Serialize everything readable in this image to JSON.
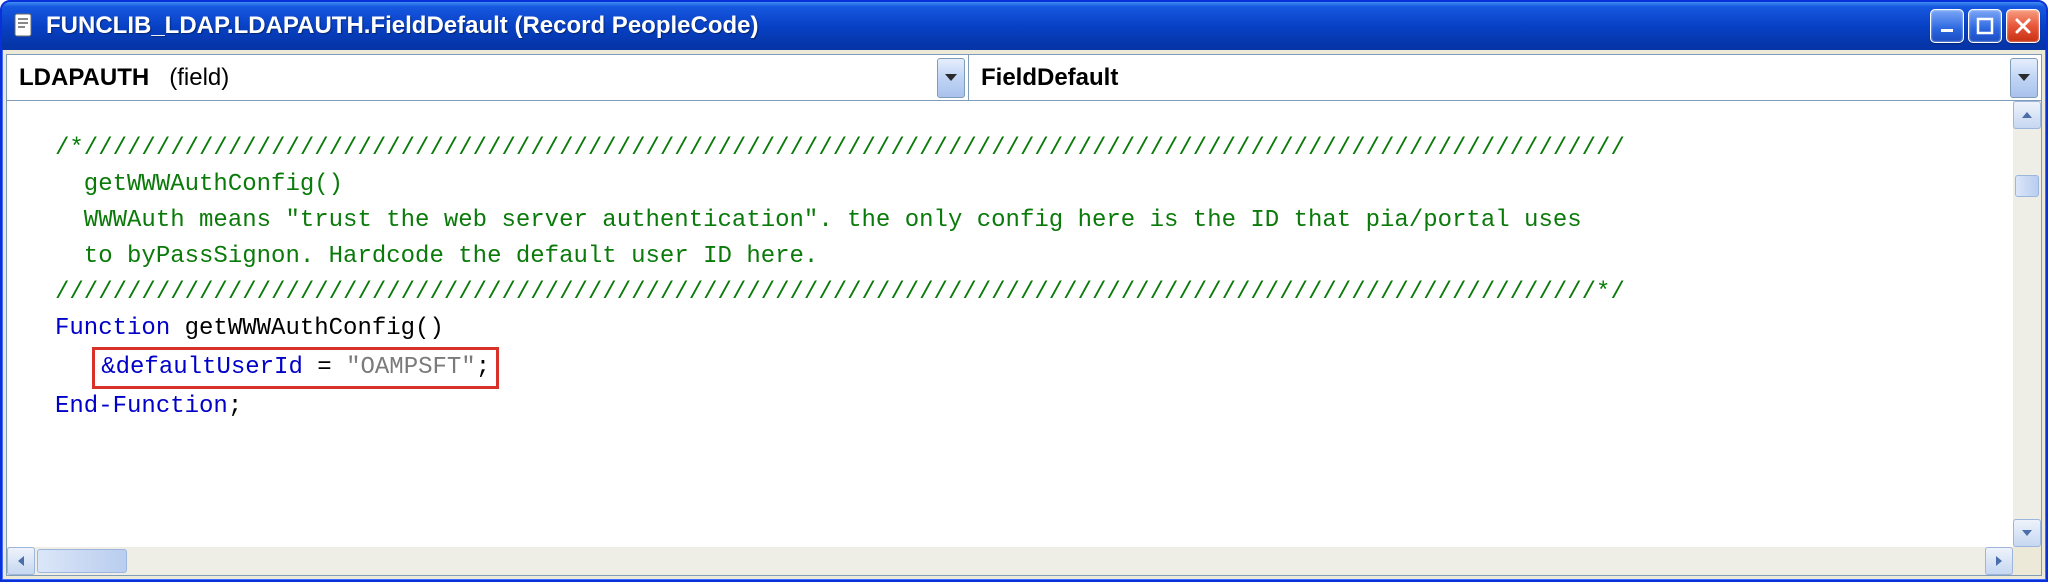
{
  "window": {
    "title": "FUNCLIB_LDAP.LDAPAUTH.FieldDefault (Record PeopleCode)"
  },
  "dropdowns": {
    "left_main": "LDAPAUTH",
    "left_sub": "(field)",
    "right": "FieldDefault"
  },
  "code": {
    "comment_bar1": "/*///////////////////////////////////////////////////////////////////////////////////////////////////////////",
    "comment_l1": "  getWWWAuthConfig()",
    "comment_l2": "  WWWAuth means \"trust the web server authentication\". the only config here is the ID that pia/portal uses",
    "comment_l3": "  to byPassSignon. Hardcode the default user ID here.",
    "comment_bar2": "///////////////////////////////////////////////////////////////////////////////////////////////////////////*/",
    "kw_function": "Function",
    "fn_name": " getWWWAuthConfig()",
    "stmt_indent": "   ",
    "var_name": "&defaultUserId",
    "eq": " = ",
    "str_val": "\"OAMPSFT\"",
    "semi": ";",
    "kw_end": "End-Function",
    "end_semi": ";"
  }
}
